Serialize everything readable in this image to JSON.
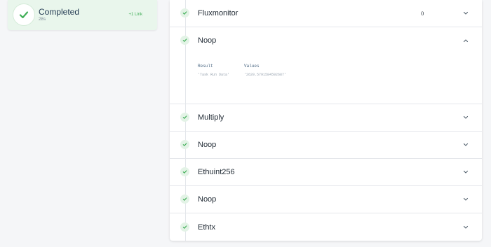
{
  "run_status": {
    "title": "Completed",
    "duration": "28s",
    "link_label": "+1 Link",
    "accent_color": "#3fae56"
  },
  "tasks": [
    {
      "name": "Fluxmonitor",
      "count": "0",
      "status": "completed",
      "expanded": false
    },
    {
      "name": "Noop",
      "status": "completed",
      "expanded": true,
      "details": {
        "headers": [
          "Result",
          "Values"
        ],
        "result": "'Task Run Data'",
        "value": "'2620.5791584592687'"
      }
    },
    {
      "name": "Multiply",
      "status": "completed",
      "expanded": false
    },
    {
      "name": "Noop",
      "status": "completed",
      "expanded": false
    },
    {
      "name": "Ethuint256",
      "status": "completed",
      "expanded": false
    },
    {
      "name": "Noop",
      "status": "completed",
      "expanded": false
    },
    {
      "name": "Ethtx",
      "status": "completed",
      "expanded": false
    }
  ],
  "icons": {
    "status": "check-icon",
    "collapsed": "chevron-down-icon",
    "expanded": "chevron-up-icon"
  }
}
